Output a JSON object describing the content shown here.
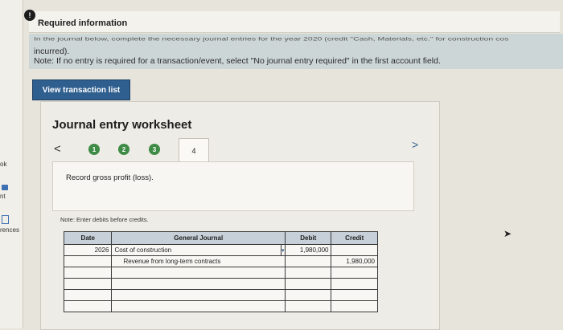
{
  "rail": {
    "items": [
      {
        "label": "ok"
      },
      {
        "label": "nt"
      },
      {
        "label": "rences"
      }
    ]
  },
  "info": {
    "badge": "!",
    "title": "Required information",
    "instructions": {
      "line1": "In the journal below, complete the necessary journal entries for the year 2020 (credit \"Cash, Materials, etc.\" for construction cos",
      "line2": "incurred).",
      "line3": "Note: If no entry is required for a transaction/event, select \"No journal entry required\" in the first account field."
    }
  },
  "view_button": "View transaction list",
  "worksheet": {
    "title": "Journal entry worksheet",
    "prev": "<",
    "next": ">",
    "steps": [
      "1",
      "2",
      "3"
    ],
    "active_tab": "4",
    "description": "Record gross profit (loss).",
    "note": "Note: Enter debits before credits.",
    "table": {
      "headers": {
        "date": "Date",
        "account": "General Journal",
        "debit": "Debit",
        "credit": "Credit"
      },
      "rows": [
        {
          "date": "2026",
          "account": "Cost of construction",
          "debit": "1,980,000",
          "credit": ""
        },
        {
          "date": "",
          "account": "Revenue from long-term contracts",
          "debit": "",
          "credit": "1,980,000"
        },
        {
          "date": "",
          "account": "",
          "debit": "",
          "credit": ""
        },
        {
          "date": "",
          "account": "",
          "debit": "",
          "credit": ""
        },
        {
          "date": "",
          "account": "",
          "debit": "",
          "credit": ""
        },
        {
          "date": "",
          "account": "",
          "debit": "",
          "credit": ""
        }
      ]
    }
  }
}
